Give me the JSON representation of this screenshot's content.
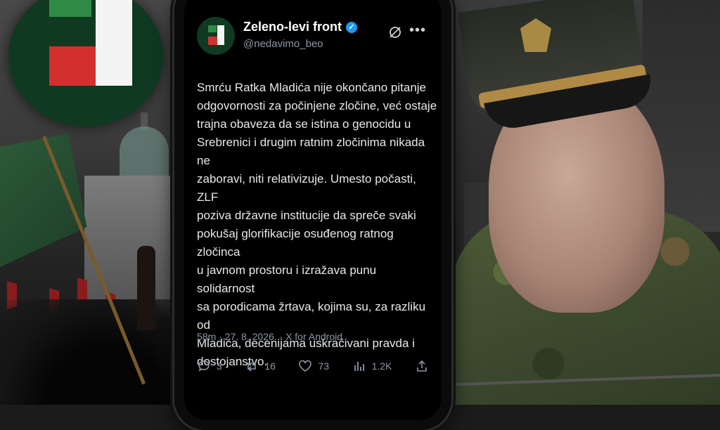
{
  "tweet": {
    "display_name": "Zeleno-levi front",
    "handle": "@nedavimo_beo",
    "lines": [
      "Smrću Ratka Mladića nije okončano pitanje",
      "odgovornosti za počinjene zločine, već ostaje",
      "trajna obaveza da se istina o genocidu u",
      "Srebrenici i drugim ratnim zločinima nikada ne",
      "zaboravi, niti relativizuje. Umesto počasti, ZLF",
      "poziva državne institucije da spreče svaki",
      "pokušaj glorifikacije osuđenog ratnog zločinca",
      "u javnom prostoru i izražava punu solidarnost",
      "sa porodicama žrtava, kojima su, za razliku od",
      "Mladića, decenijama uskraćivani pravda i",
      "dostojanstvo."
    ],
    "meta": "58m · 27. 8. 2026. · X for Android",
    "stats": {
      "replies": "3",
      "reposts": "16",
      "likes": "73",
      "views": "1.2K"
    },
    "icons": [
      "verified-badge-icon",
      "grok-icon",
      "more-icon",
      "reply-icon",
      "repost-icon",
      "like-icon",
      "views-icon",
      "share-icon"
    ]
  },
  "colors": {
    "verified": "#1d9bf0",
    "logo_green": "#2f8a46",
    "logo_red": "#d32f2f",
    "logo_bg": "#0f3a21"
  }
}
